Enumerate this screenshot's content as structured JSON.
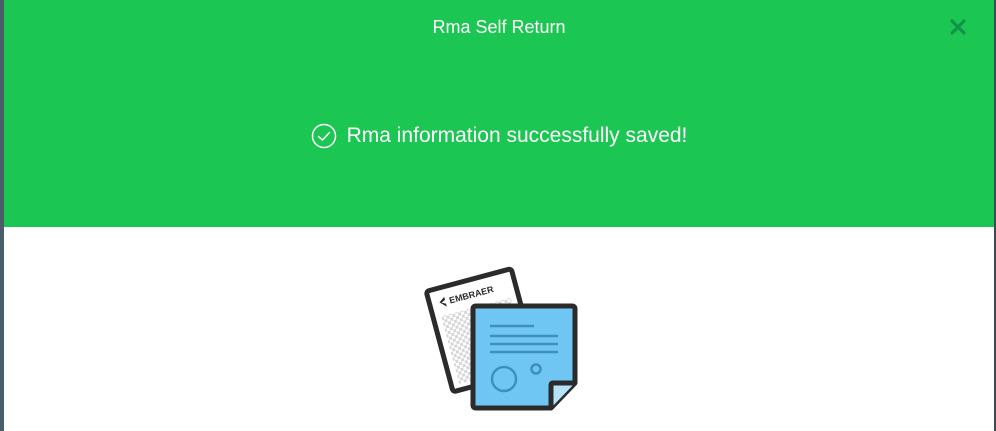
{
  "modal": {
    "title": "Rma Self Return",
    "close_icon": "close-x-icon",
    "success_message": "Rma information successfully saved!",
    "success_icon": "check-circle-icon",
    "illustration_icon": "documents-icon"
  },
  "illustration": {
    "brand_text": "EMBRAER"
  },
  "colors": {
    "header_bg": "#1cc653",
    "header_text": "#ffffff",
    "close_icon": "#12934a",
    "note_fill": "#6fc6f3",
    "outline": "#2b2b2b"
  }
}
